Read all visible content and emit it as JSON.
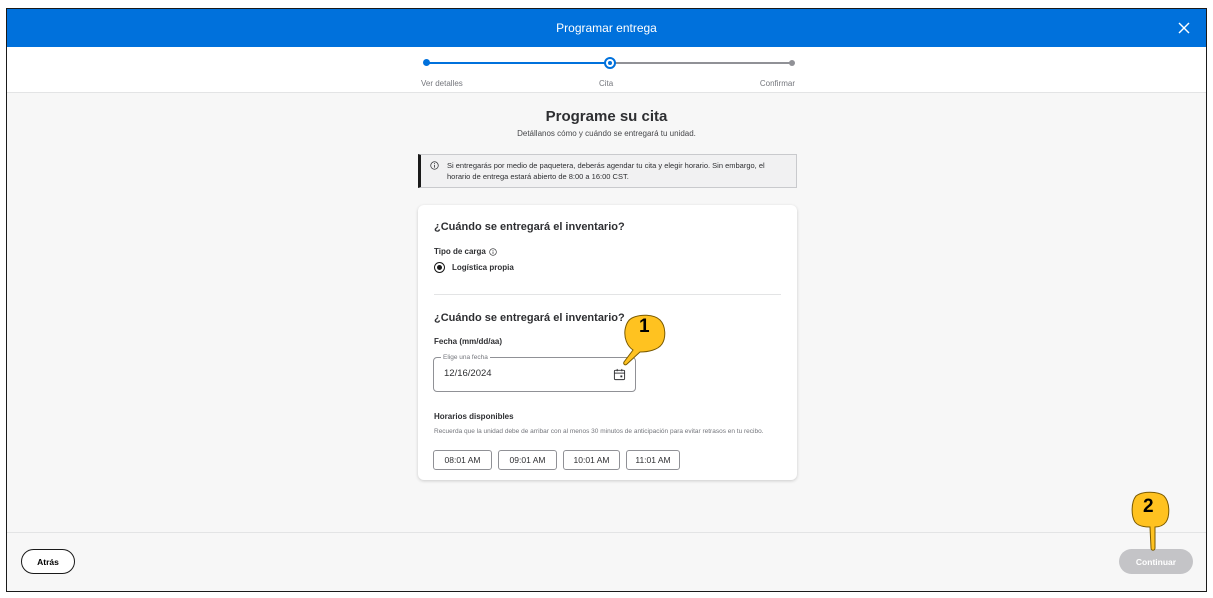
{
  "header": {
    "title": "Programar entrega"
  },
  "stepper": {
    "steps": [
      {
        "label": "Ver detalles",
        "state": "done"
      },
      {
        "label": "Cita",
        "state": "current"
      },
      {
        "label": "Confirmar",
        "state": "todo"
      }
    ]
  },
  "page": {
    "title": "Programe su cita",
    "subtitle": "Detállanos cómo y cuándo se entregará tu unidad."
  },
  "alert": {
    "text": "Si entregarás por medio de paquetera, deberás agendar tu cita y elegir horario. Sin embargo, el horario de entrega estará abierto de 8:00 a 16:00 CST."
  },
  "load_section": {
    "title": "¿Cuándo se entregará el inventario?",
    "type_label": "Tipo de carga",
    "option_label": "Logística propia"
  },
  "date_section": {
    "title": "¿Cuándo se entregará el inventario?",
    "date_label": "Fecha (mm/dd/aa)",
    "date_placeholder": "Elige una fecha",
    "date_value": "12/16/2024",
    "slots_label": "Horarios disponibles",
    "slots_hint": "Recuerda que la unidad debe de arribar con al menos 30 minutos de anticipación para evitar retrasos en tu recibo.",
    "slots": [
      "08:01 AM",
      "09:01 AM",
      "10:01 AM",
      "11:01 AM"
    ]
  },
  "footer": {
    "back_label": "Atrás",
    "next_label": "Continuar"
  },
  "annotations": {
    "marker1": "1",
    "marker2": "2"
  },
  "colors": {
    "brand_blue": "#0071dc",
    "marker_yellow": "#ffc220",
    "disabled": "#c4c4c7"
  }
}
